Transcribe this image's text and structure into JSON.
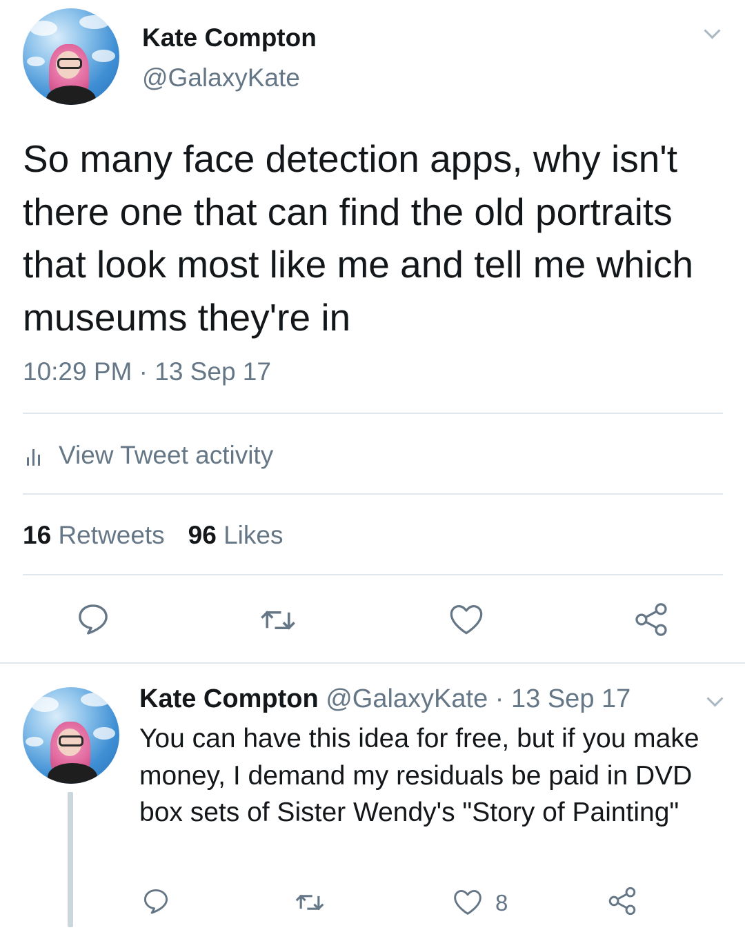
{
  "main_tweet": {
    "author_name": "Kate Compton",
    "author_handle": "@GalaxyKate",
    "text": "So many face detection apps, why isn't there one that can find the old portraits that look most like me and tell me which museums they're in",
    "timestamp": "10:29 PM · 13 Sep 17",
    "activity_label": "View Tweet activity",
    "retweet_count": "16",
    "retweet_label": "Retweets",
    "like_count": "96",
    "like_label": "Likes",
    "icons": [
      "reply-icon",
      "retweet-icon",
      "like-icon",
      "share-icon"
    ]
  },
  "reply_tweet": {
    "author_name": "Kate Compton",
    "author_handle": "@GalaxyKate",
    "date": "· 13 Sep 17",
    "text": "You can have this idea for free, but if you make money, I demand my residuals be paid in DVD box sets of Sister Wendy's \"Story of Painting\"",
    "like_count": "8",
    "icons": [
      "reply-icon",
      "retweet-icon",
      "like-icon",
      "share-icon"
    ]
  },
  "colors": {
    "text_primary": "#14171a",
    "text_secondary": "#657786",
    "divider": "#e1e8ed",
    "thread_line": "#ccd6dd"
  }
}
